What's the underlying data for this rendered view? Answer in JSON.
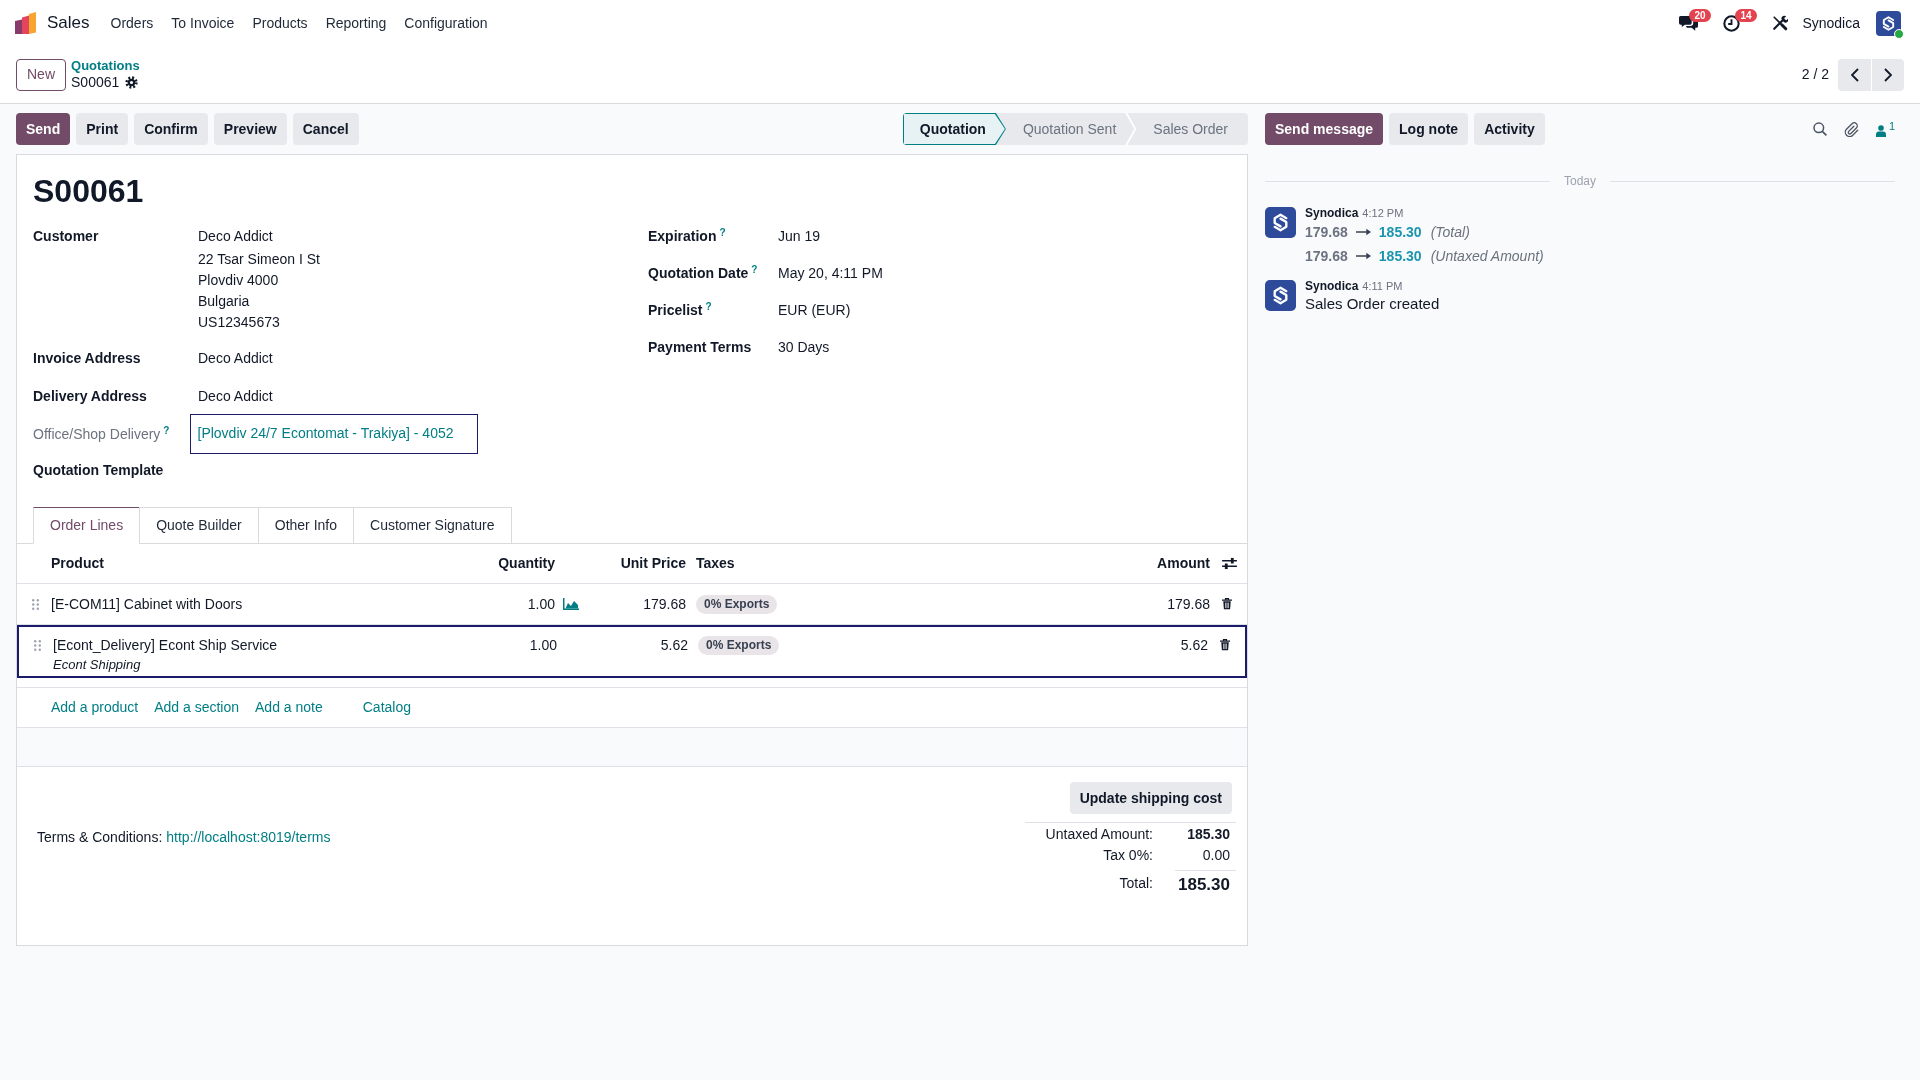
{
  "navbar": {
    "app_name": "Sales",
    "menu": [
      "Orders",
      "To Invoice",
      "Products",
      "Reporting",
      "Configuration"
    ],
    "messages_count": "20",
    "activities_count": "14",
    "user_name": "Synodica",
    "user_online": true
  },
  "control_panel": {
    "new_button": "New",
    "breadcrumb": "Quotations",
    "record_name": "S00061",
    "pager": "2 / 2"
  },
  "action_buttons": [
    {
      "label": "Send",
      "kind": "primary"
    },
    {
      "label": "Print",
      "kind": "secondary"
    },
    {
      "label": "Confirm",
      "kind": "secondary"
    },
    {
      "label": "Preview",
      "kind": "secondary"
    },
    {
      "label": "Cancel",
      "kind": "secondary"
    }
  ],
  "status_bar": [
    {
      "label": "Quotation",
      "selected": true
    },
    {
      "label": "Quotation Sent",
      "selected": false
    },
    {
      "label": "Sales Order",
      "selected": false
    }
  ],
  "form": {
    "title": "S00061",
    "left_fields": [
      {
        "label": "Customer",
        "kind": "text",
        "lines": [
          "Deco Addict",
          "22 Tsar Simeon I St",
          "Plovdiv 4000",
          "Bulgaria",
          "US12345673"
        ]
      },
      {
        "label": "Invoice Address",
        "kind": "text",
        "lines": [
          "Deco Addict"
        ]
      },
      {
        "label": "Delivery Address",
        "kind": "text",
        "lines": [
          "Deco Addict"
        ]
      },
      {
        "label": "Office/Shop Delivery",
        "kind": "link_input",
        "help": "?",
        "lines": [
          "[Plovdiv 24/7 Econtomat - Trakiya] - 4052"
        ]
      },
      {
        "label": "Quotation Template",
        "kind": "text"
      }
    ],
    "right_fields": [
      {
        "label": "Expiration",
        "help": "?",
        "value": "Jun 19"
      },
      {
        "label": "Quotation Date",
        "help": "?",
        "value": "May 20, 4:11 PM"
      },
      {
        "label": "Pricelist",
        "help": "?",
        "value": "EUR (EUR)"
      },
      {
        "label": "Payment Terms",
        "value": "30 Days"
      }
    ]
  },
  "tabs": [
    {
      "label": "Order Lines",
      "selected": true
    },
    {
      "label": "Quote Builder",
      "selected": false
    },
    {
      "label": "Other Info",
      "selected": false
    },
    {
      "label": "Customer Signature",
      "selected": false
    }
  ],
  "order_lines": {
    "columns": [
      "Product",
      "Quantity",
      "Unit Price",
      "Taxes",
      "Amount"
    ],
    "rows": [
      {
        "product": "[E-COM11] Cabinet with Doors",
        "quantity": "1.00",
        "forecast_chart": true,
        "unit_price": "179.68",
        "taxes": [
          "0% Exports"
        ],
        "amount": "179.68",
        "selected": false
      },
      {
        "product": "[Econt_Delivery] Econt Ship Service",
        "description": "Econt Shipping",
        "quantity": "1.00",
        "forecast_chart": false,
        "unit_price": "5.62",
        "taxes": [
          "0% Exports"
        ],
        "amount": "5.62",
        "selected": true
      }
    ],
    "add_links": [
      "Add a product",
      "Add a section",
      "Add a note",
      "Catalog"
    ]
  },
  "footer": {
    "update_button": "Update shipping cost",
    "terms_label": "Terms & Conditions:",
    "terms_link": "http://localhost:8019/terms",
    "totals": [
      {
        "label": "Untaxed Amount:",
        "value": "185.30",
        "kind": "subtotal"
      },
      {
        "label": "Tax 0%:",
        "value": "0.00",
        "kind": "tax"
      },
      {
        "label": "Total:",
        "value": "185.30",
        "kind": "total"
      }
    ]
  },
  "chatter": {
    "buttons": [
      {
        "label": "Send message",
        "kind": "primary"
      },
      {
        "label": "Log note",
        "kind": "secondary"
      },
      {
        "label": "Activity",
        "kind": "secondary"
      }
    ],
    "followers_count": "1",
    "date_separator": "Today",
    "messages": [
      {
        "kind": "tracking",
        "author": "Synodica",
        "time": "4:12 PM",
        "changes": [
          {
            "old": "179.68",
            "new": "185.30",
            "field": "(Total)"
          },
          {
            "old": "179.68",
            "new": "185.30",
            "field": "(Untaxed Amount)"
          }
        ]
      },
      {
        "kind": "note",
        "author": "Synodica",
        "time": "4:11 PM",
        "body": "Sales Order created"
      }
    ]
  }
}
